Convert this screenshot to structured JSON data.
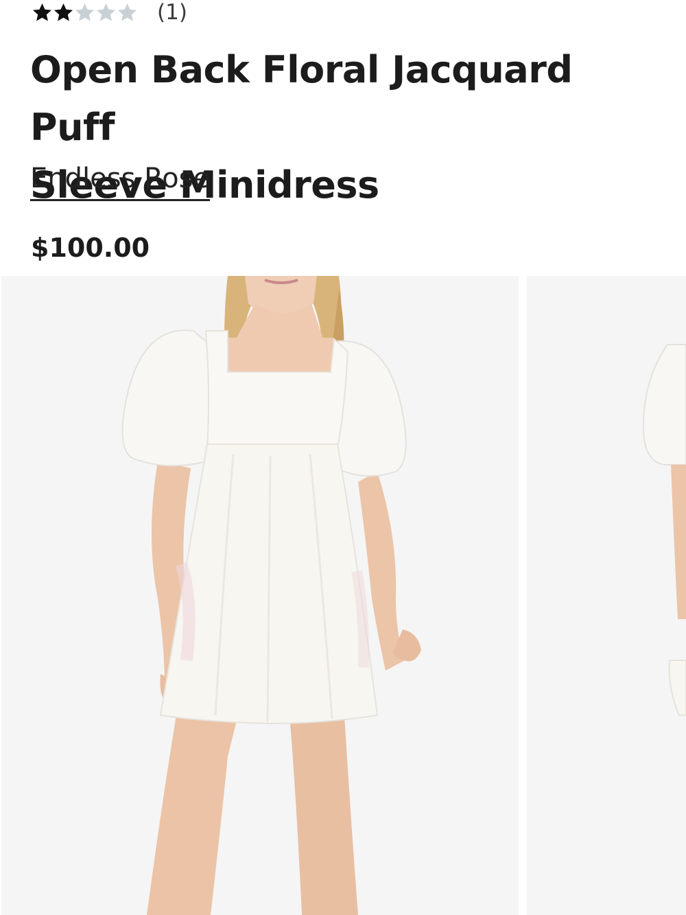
{
  "rating": {
    "value": 2,
    "max": 5,
    "count_label": "(1)",
    "filled_color": "#111111",
    "empty_color": "#c9d1d6"
  },
  "product": {
    "title_line1": "Open Back Floral Jacquard Puff",
    "title_line2": "Sleeve Minidress",
    "brand": "Endless Rose",
    "price": "$100.00"
  },
  "gallery": {
    "images": [
      {
        "description": "model-front-white-dress"
      },
      {
        "description": "model-side-white-dress"
      }
    ],
    "background_color": "#f5f5f5",
    "dress_color": "#f7f6f1"
  }
}
